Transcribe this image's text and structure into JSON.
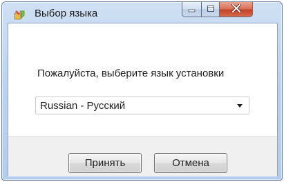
{
  "window": {
    "title": "Выбор языка",
    "app_icon": "installer-icon",
    "caption_buttons": {
      "minimize_icon": "minimize-icon",
      "maximize_icon": "maximize-icon",
      "close_icon": "close-icon"
    }
  },
  "dialog": {
    "prompt": "Пожалуйста, выберите язык установки",
    "language_select": {
      "value": "Russian - Русский",
      "icon": "chevron-down-icon"
    },
    "buttons": {
      "accept_label": "Принять",
      "cancel_label": "Отмена"
    }
  },
  "colors": {
    "titlebar": "#bcd3ee",
    "close_button": "#c2432a",
    "client_background": "#ffffff",
    "footer_background": "#f0f0f0"
  }
}
